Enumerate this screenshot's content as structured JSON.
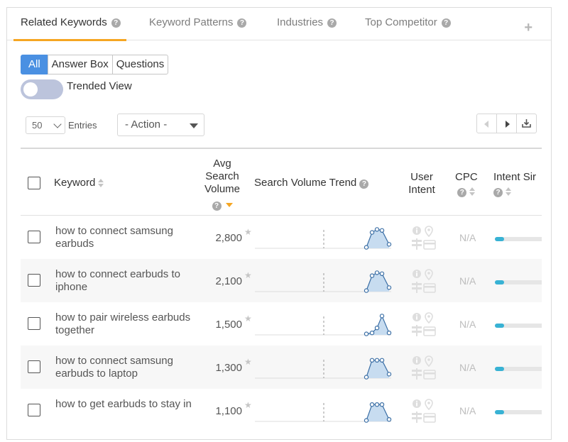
{
  "tabs": [
    {
      "label": "Related Keywords",
      "active": true
    },
    {
      "label": "Keyword Patterns",
      "active": false
    },
    {
      "label": "Industries",
      "active": false
    },
    {
      "label": "Top Competitor",
      "active": false
    }
  ],
  "add_tab_symbol": "+",
  "filters": [
    "All",
    "Answer Box",
    "Questions"
  ],
  "toggle_label": "Trended View",
  "entries": {
    "value": "50",
    "label": "Entries"
  },
  "action": {
    "value": "- Action -"
  },
  "help_symbol": "?",
  "columns": {
    "keyword": "Keyword",
    "avg_search_volume": [
      "Avg",
      "Search",
      "Volume"
    ],
    "search_volume_trend": "Search Volume Trend",
    "user_intent": [
      "User",
      "Intent"
    ],
    "cpc": "CPC",
    "intent_sim": "Intent Sir"
  },
  "colors": {
    "accent": "#4a90e2",
    "tab_underline": "#f5a623",
    "trend_line": "#3a6ea5",
    "trend_fill": "#c7dcf0",
    "intent_bar": "#38b2d4"
  },
  "rows": [
    {
      "keyword": "how to connect samsung earbuds",
      "volume": "2,800",
      "cpc": "N/A",
      "intent_sim": 0.18,
      "trend": [
        0.05,
        0.8,
        0.95,
        0.9,
        0.2
      ]
    },
    {
      "keyword": "how to connect earbuds to iphone",
      "volume": "2,100",
      "cpc": "N/A",
      "intent_sim": 0.18,
      "trend": [
        0.05,
        0.8,
        0.95,
        0.9,
        0.2
      ]
    },
    {
      "keyword": "how to pair wireless earbuds together",
      "volume": "1,500",
      "cpc": "N/A",
      "intent_sim": 0.18,
      "trend": [
        0.05,
        0.1,
        0.35,
        0.95,
        0.1
      ]
    },
    {
      "keyword": "how to connect samsung earbuds to laptop",
      "volume": "1,300",
      "cpc": "N/A",
      "intent_sim": 0.18,
      "trend": [
        0.05,
        0.9,
        0.9,
        0.9,
        0.2
      ]
    },
    {
      "keyword": "how to get earbuds to stay in",
      "volume": "1,100",
      "cpc": "N/A",
      "intent_sim": 0.18,
      "trend": [
        0.05,
        0.85,
        0.85,
        0.85,
        0.1
      ]
    }
  ]
}
